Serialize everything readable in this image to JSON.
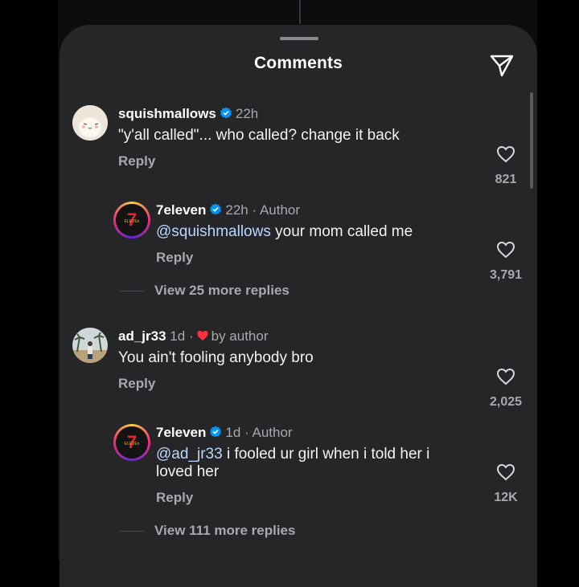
{
  "sheet": {
    "title": "Comments",
    "icons": {
      "share": "send-icon",
      "grabber": "drag-handle"
    }
  },
  "comments": [
    {
      "username": "squishmallows",
      "verified": true,
      "time": "22h",
      "text": "\"y'all called\"... who called? change it back",
      "reply_label": "Reply",
      "likes": "821",
      "replies": [
        {
          "username": "7eleven",
          "verified": true,
          "time": "22h",
          "author_tag": "· Author",
          "mention": "@squishmallows",
          "text": " your mom called me",
          "reply_label": "Reply",
          "likes": "3,791"
        }
      ],
      "view_more": "View 25 more replies"
    },
    {
      "username": "ad_jr33",
      "verified": false,
      "time": "1d",
      "dot": "·",
      "liked_by_author": "by author",
      "text": "You ain't fooling anybody bro",
      "reply_label": "Reply",
      "likes": "2,025",
      "replies": [
        {
          "username": "7eleven",
          "verified": true,
          "time": "1d",
          "author_tag": "· Author",
          "mention": "@ad_jr33",
          "text": " i fooled ur girl when i told her i",
          "text_line2": "loved her",
          "reply_label": "Reply",
          "likes": "12K"
        }
      ],
      "view_more": "View 111 more replies"
    }
  ],
  "colors": {
    "sheet_bg": "#262628",
    "mention": "#b7d7ff",
    "verified": "#0095f6",
    "heart_red": "#ff3040",
    "muted": "#a8a8ad"
  }
}
